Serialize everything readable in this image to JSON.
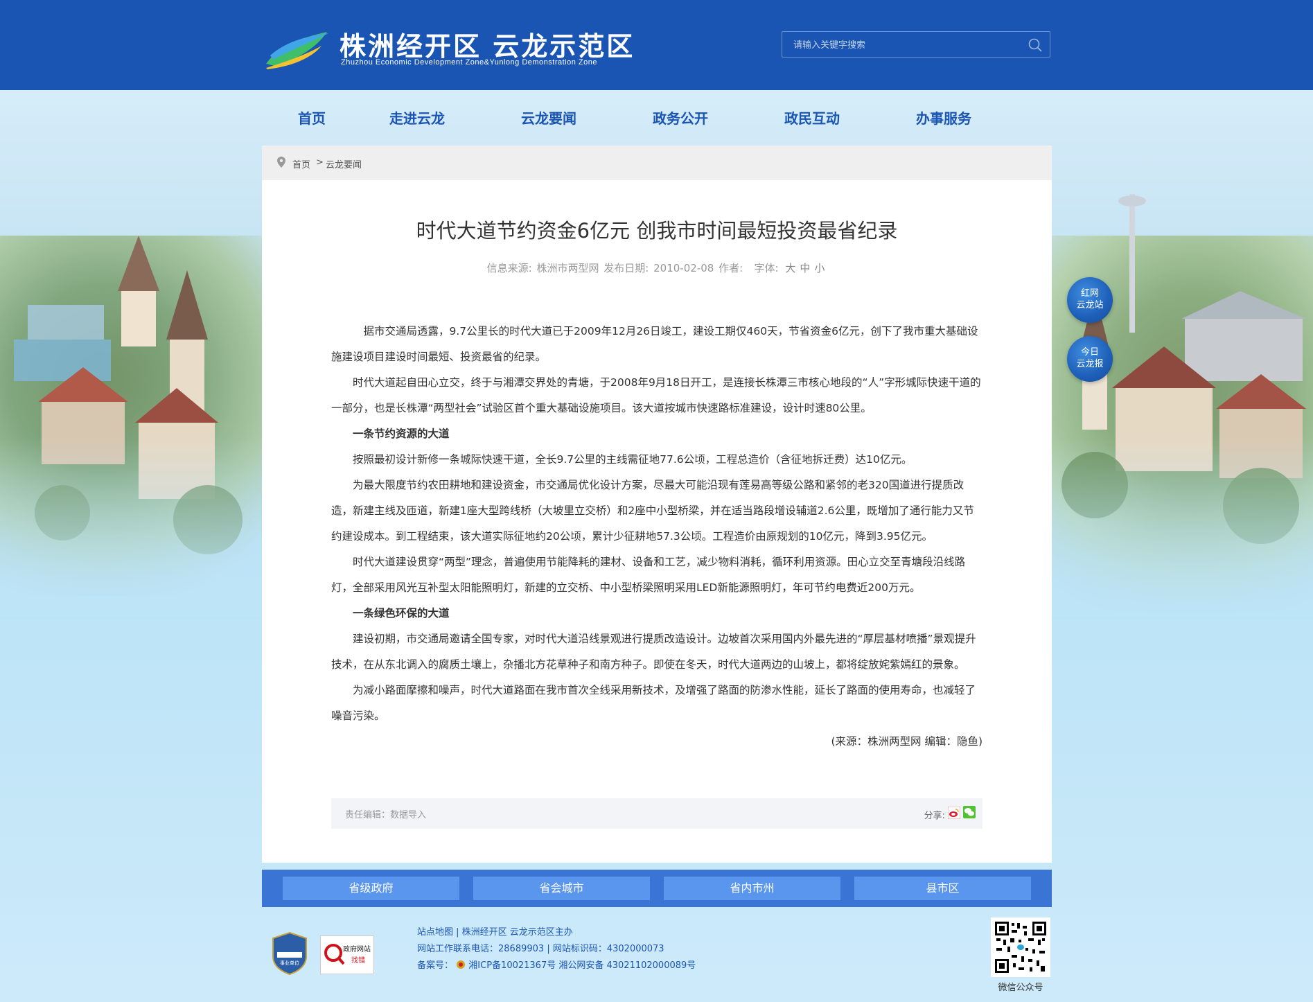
{
  "header": {
    "title": "株洲经开区 云龙示范区",
    "subtitle": "Zhuzhou Economic Development Zone&Yunlong Demonstration Zone",
    "search_placeholder": "请输入关键字搜索"
  },
  "nav": [
    "首页",
    "走进云龙",
    "云龙要闻",
    "政务公开",
    "政民互动",
    "办事服务"
  ],
  "breadcrumb": {
    "home": "首页",
    "separator": ">",
    "current": "云龙要闻"
  },
  "article": {
    "title": "时代大道节约资金6亿元 创我市时间最短投资最省纪录",
    "meta": {
      "source_label": "信息来源:",
      "source": "株洲市两型网",
      "date_label": "发布日期:",
      "date": "2010-02-08",
      "author_label": "作者:",
      "font_label": "字体:",
      "font_large": "大",
      "font_medium": "中",
      "font_small": "小"
    },
    "paragraphs": [
      "据市交通局透露，9.7公里长的时代大道已于2009年12月26日竣工，建设工期仅460天，节省资金6亿元，创下了我市重大基础设施建设项目建设时间最短、投资最省的纪录。",
      "时代大道起自田心立交，终于与湘潭交界处的青塘，于2008年9月18日开工，是连接长株潭三市核心地段的“人”字形城际快速干道的一部分，也是长株潭“两型社会”试验区首个重大基础设施项目。该大道按城市快速路标准建设，设计时速80公里。",
      "一条节约资源的大道",
      "按照最初设计新修一条城际快速干道，全长9.7公里的主线需征地77.6公顷，工程总造价（含征地拆迁费）达10亿元。",
      "为最大限度节约农田耕地和建设资金，市交通局优化设计方案，尽最大可能沿现有莲易高等级公路和紧邻的老320国道进行提质改造，新建主线及匝道，新建1座大型跨线桥（大坡里立交桥）和2座中小型桥梁，并在适当路段增设辅道2.6公里，既增加了通行能力又节约建设成本。到工程结束，该大道实际征地约20公顷，累计少征耕地57.3公顷。工程造价由原规划的10亿元，降到3.95亿元。",
      "时代大道建设贯穿“两型”理念，普遍使用节能降耗的建材、设备和工艺，减少物料消耗，循环利用资源。田心立交至青塘段沿线路灯，全部采用风光互补型太阳能照明灯，新建的立交桥、中小型桥梁照明采用LED新能源照明灯，年可节约电费近200万元。",
      "一条绿色环保的大道",
      "建设初期，市交通局邀请全国专家，对时代大道沿线景观进行提质改造设计。边坡首次采用国内外最先进的“厚层基材喷播”景观提升技术，在从东北调入的腐质土壤上，杂播北方花草种子和南方种子。即使在冬天，时代大道两边的山坡上，都将绽放姹紫嫣红的景象。",
      "为减小路面摩擦和噪声，时代大道路面在我市首次全线采用新技术，及增强了路面的防渗水性能，延长了路面的使用寿命，也减轻了噪音污染。"
    ],
    "source_line": "(来源：株洲两型网  编辑：隐鱼)",
    "editor": "责任编辑：数据导入",
    "share_label": "分享:"
  },
  "side_buttons": [
    {
      "line1": "红网",
      "line2": "云龙站"
    },
    {
      "line1": "今日",
      "line2": "云龙报"
    }
  ],
  "links": [
    "省级政府",
    "省会城市",
    "省内市州",
    "县市区"
  ],
  "footer": {
    "sitemap": "站点地图",
    "host": "株洲经开区 云龙示范区主办",
    "phone_label": "网站工作联系电话：",
    "phone": "28689903",
    "site_id_label": "网站标识码：",
    "site_id": "4302000073",
    "icp_label": "备案号：",
    "icp": "湘ICP备10021367号",
    "police": "湘公网安备 43021102000089号",
    "badge2_line1": "政府网站",
    "badge2_line2": "找错",
    "badge1_text": "事业单位",
    "qr_caption": "微信公众号"
  },
  "colors": {
    "header": "#1a55b3",
    "nav_text": "#1a55b3",
    "links_bar": "#3a74d4",
    "links_btn": "#5a95ee"
  }
}
